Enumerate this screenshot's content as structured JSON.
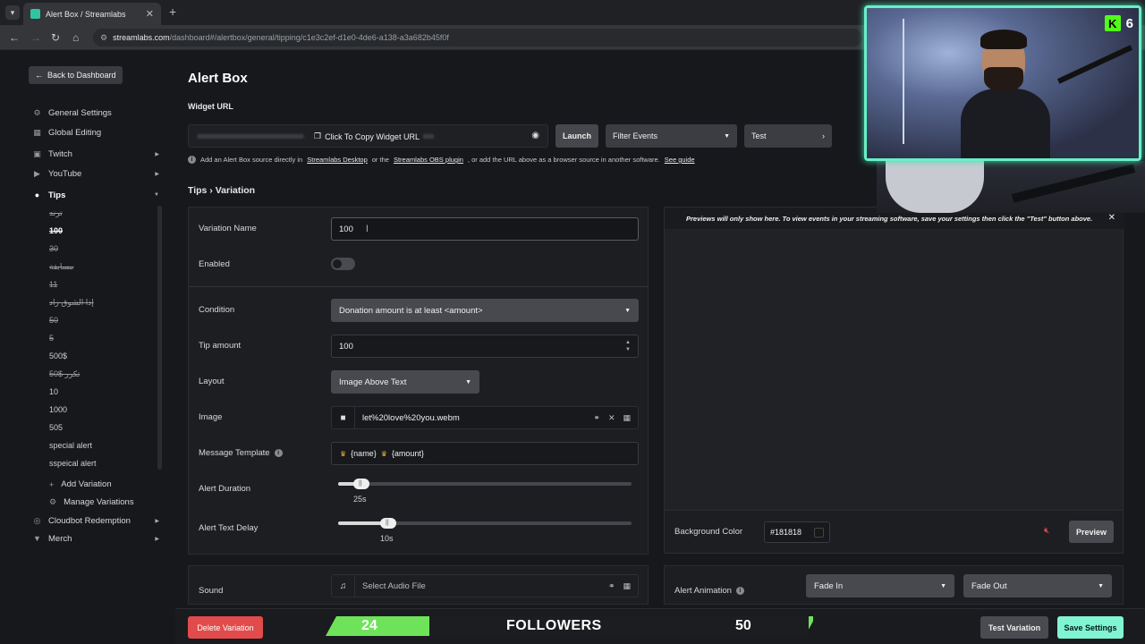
{
  "browser": {
    "tab_title": "Alert Box / Streamlabs",
    "tab_close": "✕",
    "new_tab": "+",
    "url_domain": "streamlabs.com",
    "url_path": "/dashboard#/alertbox/general/tipping/c1e3c2ef-d1e0-4de6-a138-a3a682b45f0f"
  },
  "sidebar": {
    "back_label": "Back to Dashboard",
    "items": [
      {
        "label": "General Settings",
        "icon": "gear-icon"
      },
      {
        "label": "Global Editing",
        "icon": "grid-icon"
      },
      {
        "label": "Twitch",
        "icon": "twitch-icon"
      },
      {
        "label": "YouTube",
        "icon": "youtube-icon"
      },
      {
        "label": "Tips",
        "icon": "tips-icon"
      }
    ],
    "variations": [
      "ترند",
      "100",
      "30",
      "مسابقة",
      "11",
      "إذا الشوق زاد",
      "50",
      "5",
      "500$",
      "50$ تكرر",
      "10",
      "1000",
      "505",
      "special alert",
      "sspeical alert"
    ],
    "add_variation": "Add Variation",
    "manage_variations": "Manage Variations",
    "cloudbot": "Cloudbot Redemption",
    "merch": "Merch"
  },
  "main": {
    "title": "Alert Box",
    "widget_url_label": "Widget URL",
    "copy_url": "Click To Copy Widget URL",
    "launch": "Launch",
    "filter_events": "Filter Events",
    "test": "Test",
    "info": {
      "prefix": "Add an Alert Box source directly in",
      "link1": "Streamlabs Desktop",
      "mid": "or the",
      "link2": "Streamlabs OBS plugin",
      "suffix": ", or add the URL above as a browser source in another software.",
      "link3": "See guide"
    },
    "breadcrumb": "Tips › Variation"
  },
  "form": {
    "variation_name_label": "Variation Name",
    "variation_name_value": "100",
    "enabled_label": "Enabled",
    "condition_label": "Condition",
    "condition_value": "Donation amount is at least <amount>",
    "tip_amount_label": "Tip amount",
    "tip_amount_value": "100",
    "layout_label": "Layout",
    "layout_value": "Image Above Text",
    "image_label": "Image",
    "image_value": "let%20love%20you.webm",
    "message_template_label": "Message Template",
    "template_name": "{name}",
    "template_amount": "{amount}",
    "alert_duration_label": "Alert Duration",
    "alert_duration_value": "25s",
    "alert_duration_fraction": 0.08,
    "alert_text_delay_label": "Alert Text Delay",
    "alert_text_delay_value": "10s",
    "alert_text_delay_fraction": 0.17,
    "sound_label": "Sound",
    "sound_value": "Select Audio File"
  },
  "preview": {
    "message": "Previews will only show here. To view events in your streaming software, save your settings then click the \"Test\" button above.",
    "bg_label": "Background Color",
    "bg_value": "#181818",
    "preview_btn": "Preview",
    "alert_animation_label": "Alert Animation",
    "anim_in": "Fade In",
    "anim_out": "Fade Out"
  },
  "bottom": {
    "delete": "Delete Variation",
    "test_variation": "Test Variation",
    "save": "Save Settings"
  },
  "overlay": {
    "goal_current": "24",
    "goal_title": "FOLLOWERS",
    "goal_target": "50",
    "kick_logo": "K",
    "kick_count": "6"
  },
  "colors": {
    "accent": "#80f5d2",
    "danger": "#e24b4b",
    "goal_fill": "#6ee35a",
    "cam_border": "#67f0c6"
  }
}
